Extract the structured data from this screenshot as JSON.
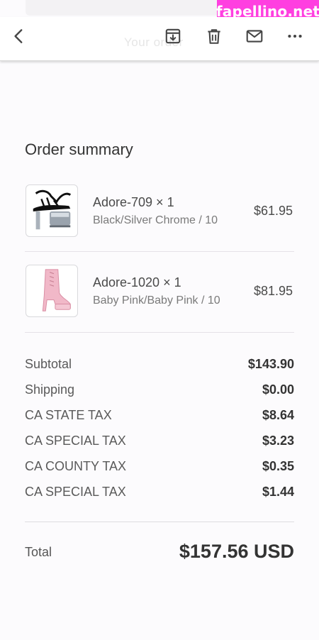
{
  "watermark": "fapellino.net",
  "toolbar": {
    "ghost_text": "Your order",
    "back_icon": "chevron-left-icon",
    "archive_icon": "archive-download-icon",
    "delete_icon": "trash-icon",
    "mail_icon": "envelope-icon",
    "more_icon": "more-dots-icon"
  },
  "order": {
    "title": "Order summary",
    "items": [
      {
        "name": "Adore-709 × 1",
        "variant": "Black/Silver Chrome / 10",
        "price": "$61.95",
        "image": "black-silver-platform-heel-image"
      },
      {
        "name": "Adore-1020 × 1",
        "variant": "Baby Pink/Baby Pink / 10",
        "price": "$81.95",
        "image": "pink-platform-boot-image"
      }
    ],
    "summary": [
      {
        "label": "Subtotal",
        "value": "$143.90"
      },
      {
        "label": "Shipping",
        "value": "$0.00"
      },
      {
        "label": "CA STATE TAX",
        "value": "$8.64"
      },
      {
        "label": "CA SPECIAL TAX",
        "value": "$3.23"
      },
      {
        "label": "CA COUNTY TAX",
        "value": "$0.35"
      },
      {
        "label": "CA SPECIAL TAX",
        "value": "$1.44"
      }
    ],
    "total_label": "Total",
    "total_value": "$157.56 USD"
  },
  "colors": {
    "watermark_bg": "#ff3fe0",
    "text": "#333333",
    "muted": "#7a7a7a"
  }
}
